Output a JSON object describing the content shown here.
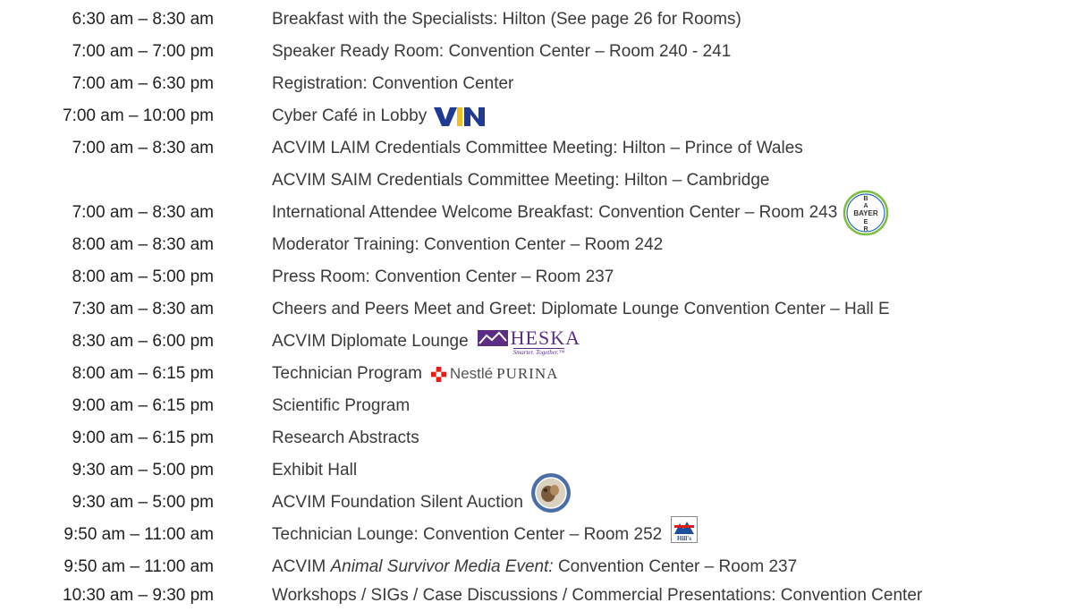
{
  "schedule": [
    {
      "time": "6:30 am – 8:30 am",
      "desc": "Breakfast with the Specialists: Hilton (See page 26 for Rooms)"
    },
    {
      "time": "7:00 am – 7:00 pm",
      "desc": "Speaker Ready Room: Convention Center – Room 240 - 241"
    },
    {
      "time": "7:00 am – 6:30 pm",
      "desc": "Registration: Convention Center"
    },
    {
      "time": "7:00 am – 10:00 pm",
      "desc": "Cyber Café in Lobby",
      "logo": "vin-logo"
    },
    {
      "time": "7:00 am – 8:30 am",
      "desc": "ACVIM LAIM Credentials Committee Meeting: Hilton – Prince of Wales"
    },
    {
      "time": "",
      "desc": "ACVIM SAIM Credentials Committee Meeting: Hilton – Cambridge"
    },
    {
      "time": "7:00 am – 8:30 am",
      "desc": "International Attendee Welcome Breakfast: Convention Center – Room 243",
      "logo": "bayer-logo"
    },
    {
      "time": "8:00 am – 8:30 am",
      "desc": "Moderator Training: Convention Center – Room 242"
    },
    {
      "time": "8:00 am – 5:00 pm",
      "desc": "Press Room: Convention Center – Room 237"
    },
    {
      "time": "7:30 am – 8:30 am",
      "desc": "Cheers and Peers Meet and Greet: Diplomate Lounge Convention Center – Hall E"
    },
    {
      "time": "8:30 am – 6:00 pm",
      "desc": "ACVIM Diplomate Lounge",
      "logo": "heska-logo"
    },
    {
      "time": "8:00 am – 6:15 pm",
      "desc": "Technician Program",
      "logo": "nestle-purina-logo"
    },
    {
      "time": "9:00 am – 6:15 pm",
      "desc": "Scientific Program"
    },
    {
      "time": "9:00 am – 6:15 pm",
      "desc": "Research Abstracts"
    },
    {
      "time": "9:30 am – 5:00 pm",
      "desc": "Exhibit Hall"
    },
    {
      "time": "9:30 am – 5:00 pm",
      "desc": "ACVIM Foundation Silent Auction",
      "logo": "acvim-foundation-seal"
    },
    {
      "time": "9:50 am – 11:00 am",
      "desc": "Technician Lounge: Convention Center – Room 252",
      "logo": "hills-logo"
    },
    {
      "time": "9:50 am – 11:00 am",
      "desc_pre": "ACVIM ",
      "desc_italic": "Animal Survivor Media Event:",
      "desc_post": " Convention Center – Room 237"
    },
    {
      "time": "10:30 am – 9:30 pm",
      "desc": "Workshops / SIGs / Case Discussions / Commercial Presentations: Convention Center"
    }
  ],
  "logos": {
    "vin": "VIN",
    "bayer": "BAYER",
    "heska": "HESKA",
    "heska_tagline": "Smarter. Together.™",
    "nestle": "Nestlé",
    "purina": "PURINA",
    "hills": "Hill's"
  },
  "colors": {
    "time_text": "#1f1f1f",
    "desc_text": "#3a3a3c",
    "vin_blue": "#1f3a93",
    "vin_gold": "#f0c020",
    "bayer_green": "#7cbd3c",
    "heska_purple": "#5b2d83",
    "purina_red": "#e31d1a",
    "hills_blue": "#1d4f9e"
  }
}
